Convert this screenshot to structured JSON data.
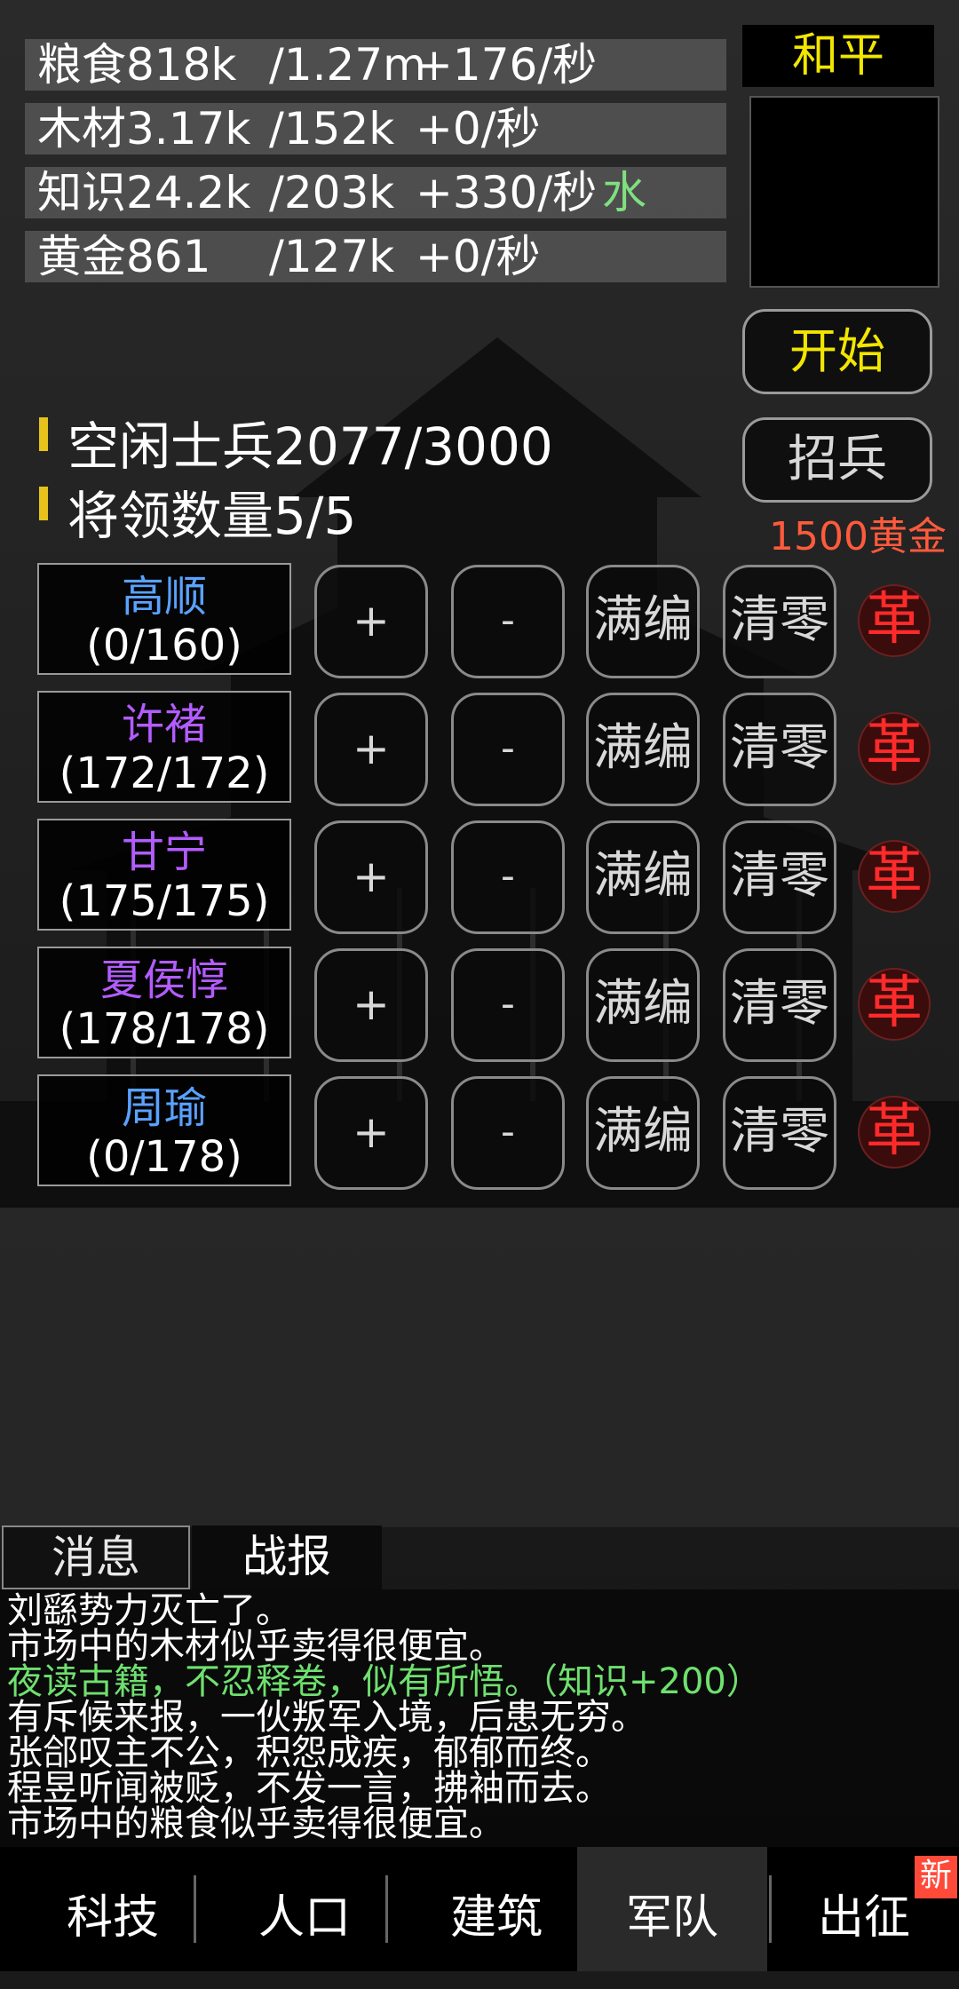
{
  "resources": [
    {
      "name": "粮食818k",
      "cap": "/1.27m",
      "rate": "+176/秒",
      "extra": ""
    },
    {
      "name": "木材3.17k",
      "cap": "/152k",
      "rate": "+0/秒",
      "extra": ""
    },
    {
      "name": "知识24.2k",
      "cap": "/203k",
      "rate": "+330/秒",
      "extra": "水"
    },
    {
      "name": "黄金861",
      "cap": "/127k",
      "rate": "+0/秒",
      "extra": ""
    }
  ],
  "status": {
    "label": "和平"
  },
  "controls": {
    "start": "开始",
    "recruit": "招兵",
    "recruit_cost": "1500黄金"
  },
  "stats": {
    "idle_soldiers": "空闲士兵2077/3000",
    "generals": "将领数量5/5"
  },
  "generals": [
    {
      "name": "高顺",
      "count": "(0/160)"
    },
    {
      "name": "许褚",
      "count": "(172/172)"
    },
    {
      "name": "甘宁",
      "count": "(175/175)"
    },
    {
      "name": "夏侯惇",
      "count": "(178/178)"
    },
    {
      "name": "周瑜",
      "count": "(0/178)"
    }
  ],
  "actions": {
    "plus": "+",
    "minus": "-",
    "full": "满编",
    "clear": "清零",
    "revoke": "革"
  },
  "tabs": {
    "messages": "消息",
    "battle": "战报"
  },
  "log": [
    "刘繇势力灭亡了。",
    "市场中的木材似乎卖得很便宜。",
    "夜读古籍，不忍释卷，似有所悟。（知识+200）",
    "有斥候来报，一伙叛军入境，后患无穷。",
    "张郃叹主不公，积怨成疾，郁郁而终。",
    "程昱听闻被贬，不发一言，拂袖而去。",
    "市场中的粮食似乎卖得很便宜。"
  ],
  "nav": {
    "tech": "科技",
    "population": "人口",
    "buildings": "建筑",
    "army": "军队",
    "expedition": "出征",
    "new_badge": "新"
  }
}
